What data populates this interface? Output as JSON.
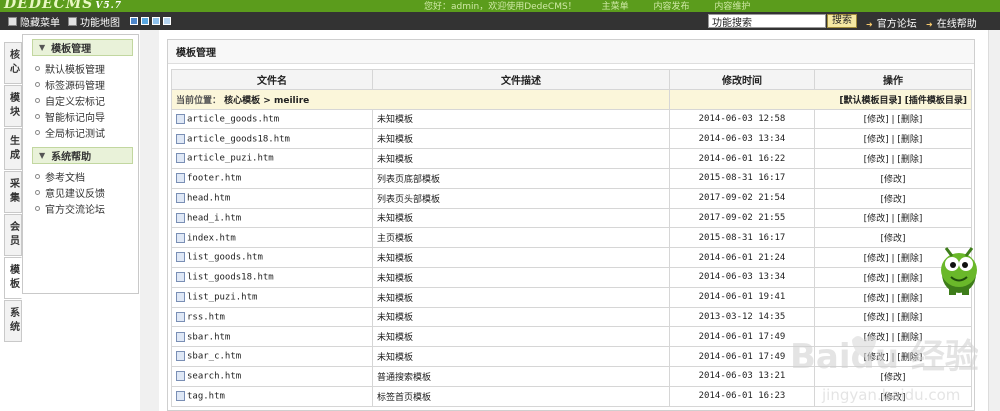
{
  "app": {
    "logo": "DEDECMS",
    "version": "V5.7",
    "top_links": [
      "您好：admin，欢迎使用DedeCMS！",
      "主菜单",
      "内容发布",
      "内容维护"
    ]
  },
  "toolbar": {
    "hide_menu": "隐藏菜单",
    "site_map": "功能地图",
    "swatch_colors": [
      "#4e86c8",
      "#5aa7e0",
      "#8fc1ec",
      "#b5d3ee"
    ],
    "search_value": "功能搜索",
    "search_button": "搜索",
    "forum_link": "官方论坛",
    "help_link": "在线帮助"
  },
  "vertical_tabs": [
    {
      "label": "核心",
      "active": false
    },
    {
      "label": "模块",
      "active": false
    },
    {
      "label": "生成",
      "active": false
    },
    {
      "label": "采集",
      "active": false
    },
    {
      "label": "会员",
      "active": false
    },
    {
      "label": "模板",
      "active": true
    },
    {
      "label": "系统",
      "active": false
    }
  ],
  "sidebar": {
    "sections": [
      {
        "title": "模板管理",
        "items": [
          "默认模板管理",
          "标签源码管理",
          "自定义宏标记",
          "智能标记向导",
          "全局标记测试"
        ]
      },
      {
        "title": "系统帮助",
        "items": [
          "参考文档",
          "意见建议反馈",
          "官方交流论坛"
        ]
      }
    ]
  },
  "main": {
    "title": "模板管理",
    "columns": [
      "文件名",
      "文件描述",
      "修改时间",
      "操作"
    ],
    "location": {
      "label": "当前位置：",
      "path": "核心模板 > meilire",
      "right": "[默认模板目录] [插件模板目录]"
    },
    "rows": [
      {
        "file": "article_goods.htm",
        "desc": "未知模板",
        "mtime": "2014-06-03 12:58",
        "ops": "[修改] | [删除]"
      },
      {
        "file": "article_goods18.htm",
        "desc": "未知模板",
        "mtime": "2014-06-03 13:34",
        "ops": "[修改] | [删除]"
      },
      {
        "file": "article_puzi.htm",
        "desc": "未知模板",
        "mtime": "2014-06-01 16:22",
        "ops": "[修改] | [删除]"
      },
      {
        "file": "footer.htm",
        "desc": "列表页底部模板",
        "mtime": "2015-08-31 16:17",
        "ops": "[修改]"
      },
      {
        "file": "head.htm",
        "desc": "列表页头部模板",
        "mtime": "2017-09-02 21:54",
        "ops": "[修改]"
      },
      {
        "file": "head_i.htm",
        "desc": "未知模板",
        "mtime": "2017-09-02 21:55",
        "ops": "[修改] | [删除]"
      },
      {
        "file": "index.htm",
        "desc": "主页模板",
        "mtime": "2015-08-31 16:17",
        "ops": "[修改]"
      },
      {
        "file": "list_goods.htm",
        "desc": "未知模板",
        "mtime": "2014-06-01 21:24",
        "ops": "[修改] | [删除]"
      },
      {
        "file": "list_goods18.htm",
        "desc": "未知模板",
        "mtime": "2014-06-03 13:34",
        "ops": "[修改] | [删除]"
      },
      {
        "file": "list_puzi.htm",
        "desc": "未知模板",
        "mtime": "2014-06-01 19:41",
        "ops": "[修改] | [删除]"
      },
      {
        "file": "rss.htm",
        "desc": "未知模板",
        "mtime": "2013-03-12 14:35",
        "ops": "[修改] | [删除]"
      },
      {
        "file": "sbar.htm",
        "desc": "未知模板",
        "mtime": "2014-06-01 17:49",
        "ops": "[修改] | [删除]"
      },
      {
        "file": "sbar_c.htm",
        "desc": "未知模板",
        "mtime": "2014-06-01 17:49",
        "ops": "[修改] | [删除]"
      },
      {
        "file": "search.htm",
        "desc": "普通搜索模板",
        "mtime": "2014-06-03 13:21",
        "ops": "[修改]"
      },
      {
        "file": "tag.htm",
        "desc": "标签首页模板",
        "mtime": "2014-06-01 16:23",
        "ops": "[修改]"
      }
    ]
  },
  "watermark": {
    "brand": "Bai du 经验",
    "url": "jingyan.baidu.com"
  },
  "colors": {
    "header_green": "#5b9c1c",
    "toolbar": "#333333",
    "location_bar": "#fbf6da"
  }
}
